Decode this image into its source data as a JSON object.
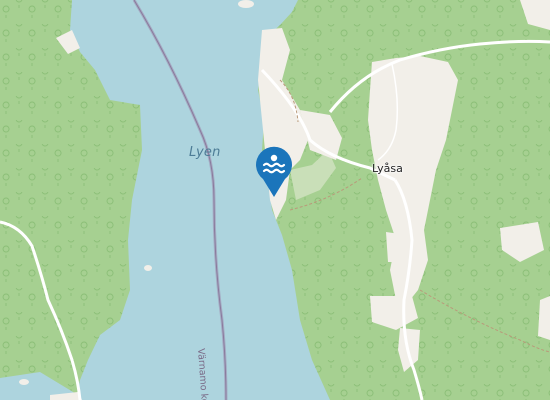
{
  "map": {
    "labels": {
      "lake": "Lyen",
      "place": "Lyåsa",
      "boundary": "Värnamo kommun"
    },
    "marker": {
      "icon": "swimming-icon",
      "color": "#1b75bb"
    },
    "colors": {
      "water": "#add4de",
      "forest": "#a6d091",
      "clearing": "#f2efe9",
      "road": "#ffffff",
      "boundary": "#9e8fb0"
    }
  }
}
